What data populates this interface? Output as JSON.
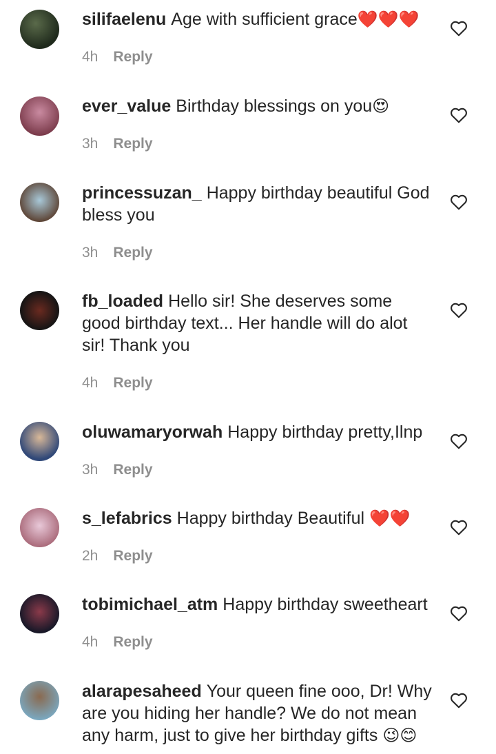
{
  "comments": [
    {
      "username": "silifaelenu",
      "text": "Age with sufficient grace",
      "emoji": "❤️❤️❤️",
      "time": "4h",
      "reply": "Reply"
    },
    {
      "username": "ever_value",
      "text": "Birthday blessings on you",
      "emoji": "😍",
      "time": "3h",
      "reply": "Reply"
    },
    {
      "username": "princessuzan_",
      "text": "Happy birthday beautiful God bless you",
      "emoji": "",
      "time": "3h",
      "reply": "Reply"
    },
    {
      "username": "fb_loaded",
      "text": "Hello sir! She deserves some good birthday text... Her handle will do alot sir! Thank you",
      "emoji": "",
      "time": "4h",
      "reply": "Reply"
    },
    {
      "username": "oluwamaryorwah",
      "text": "Happy birthday pretty,Ilnp",
      "emoji": "",
      "time": "3h",
      "reply": "Reply"
    },
    {
      "username": "s_lefabrics",
      "text": "Happy birthday Beautiful ",
      "emoji": "❤️❤️",
      "time": "2h",
      "reply": "Reply"
    },
    {
      "username": "tobimichael_atm",
      "text": "Happy birthday sweetheart",
      "emoji": "",
      "time": "4h",
      "reply": "Reply"
    },
    {
      "username": "alarapesaheed",
      "text": "Your queen fine ooo, Dr! Why are you hiding her handle? We do not mean any harm, just to give her birthday gifts ",
      "emoji": "😉😊",
      "time": "",
      "reply": ""
    }
  ],
  "colors": {
    "text": "#262626",
    "meta": "#8e8e8e",
    "heart": "#e0202a"
  },
  "icons": {
    "like": "heart-outline-icon"
  }
}
